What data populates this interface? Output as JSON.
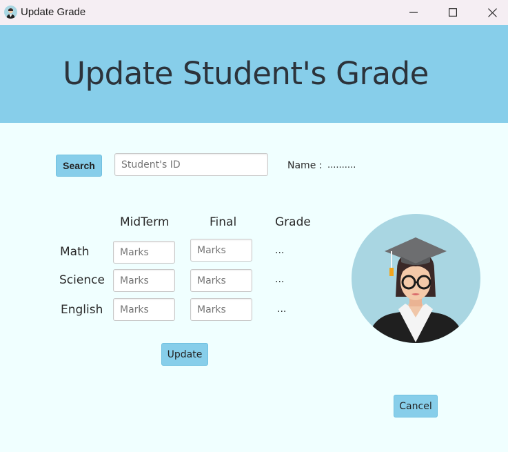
{
  "window": {
    "title": "Update Grade",
    "icon": "student-avatar-icon"
  },
  "header": {
    "title": "Update Student's Grade",
    "background": "#87ceea"
  },
  "search": {
    "button_label": "Search",
    "id_placeholder": "Student's ID",
    "name_label": "Name :",
    "name_value": ".........."
  },
  "grades": {
    "columns": [
      "MidTerm",
      "Final",
      "Grade"
    ],
    "rows": [
      {
        "subject": "Math",
        "midterm_placeholder": "Marks",
        "final_placeholder": "Marks",
        "grade": "..."
      },
      {
        "subject": "Science",
        "midterm_placeholder": "Marks",
        "final_placeholder": "Marks",
        "grade": "..."
      },
      {
        "subject": "English",
        "midterm_placeholder": "Marks",
        "final_placeholder": "Marks",
        "grade": "..."
      }
    ]
  },
  "actions": {
    "update_label": "Update",
    "cancel_label": "Cancel"
  },
  "illustration": {
    "icon": "graduate-avatar-icon"
  }
}
